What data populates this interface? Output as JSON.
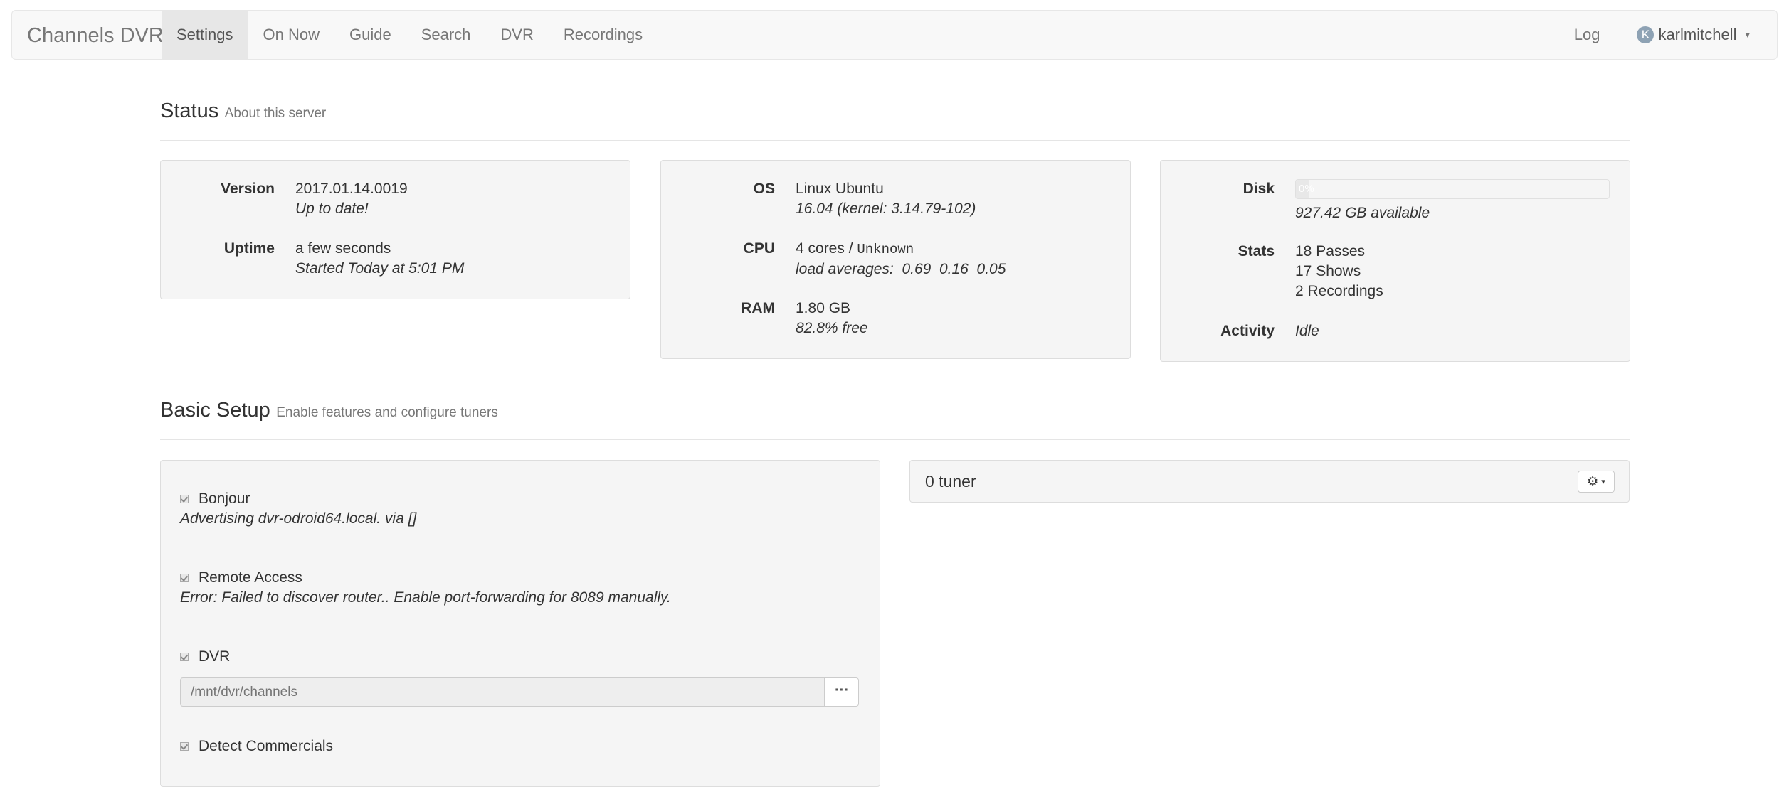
{
  "nav": {
    "brand": "Channels DVR",
    "items": [
      "Settings",
      "On Now",
      "Guide",
      "Search",
      "DVR",
      "Recordings"
    ],
    "log": "Log",
    "user": {
      "initial": "K",
      "name": "karlmitchell"
    }
  },
  "status": {
    "title": "Status",
    "subtitle": "About this server",
    "version": {
      "label": "Version",
      "value": "2017.01.14.0019",
      "note": "Up to date!"
    },
    "uptime": {
      "label": "Uptime",
      "value": "a few seconds",
      "note": "Started Today at 5:01 PM"
    },
    "os": {
      "label": "OS",
      "value": "Linux Ubuntu",
      "note": "16.04 (kernel: 3.14.79-102)"
    },
    "cpu": {
      "label": "CPU",
      "cores": "4 cores / ",
      "model": "Unknown",
      "load_label": "load averages:",
      "loads": [
        "0.69",
        "0.16",
        "0.05"
      ]
    },
    "ram": {
      "label": "RAM",
      "value": "1.80 GB",
      "note": "82.8% free"
    },
    "disk": {
      "label": "Disk",
      "bar_text": "0%",
      "used_fraction": 0.01,
      "available": "927.42 GB available"
    },
    "stats": {
      "label": "Stats",
      "passes": "18 Passes",
      "shows": "17 Shows",
      "recordings": "2 Recordings"
    },
    "activity": {
      "label": "Activity",
      "value": "Idle"
    }
  },
  "setup": {
    "title": "Basic Setup",
    "subtitle": "Enable features and configure tuners",
    "bonjour": {
      "label": "Bonjour",
      "desc": "Advertising dvr-odroid64.local. via []"
    },
    "remote": {
      "label": "Remote Access",
      "desc": "Error: Failed to discover router.. Enable port-forwarding for 8089 manually."
    },
    "dvr": {
      "label": "DVR",
      "path_placeholder": "/mnt/dvr/channels",
      "browse_label": "···"
    },
    "commercials": {
      "label": "Detect Commercials"
    },
    "tuners": {
      "title": "0 tuner"
    }
  }
}
